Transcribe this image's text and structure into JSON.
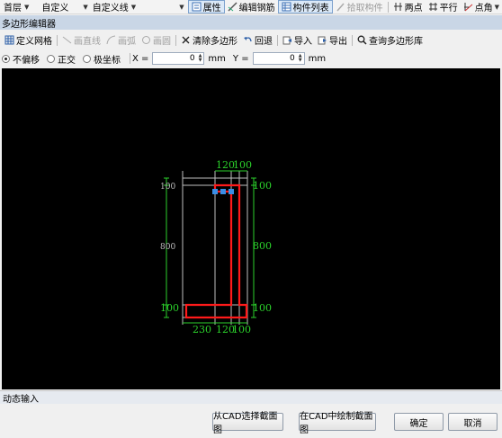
{
  "top_toolbar": {
    "floor": "首层",
    "custom": "自定义",
    "custom_line": "自定义线",
    "blank_dd": "",
    "attributes": "属性",
    "edit_rebar": "编辑钢筋",
    "component_list": "构件列表",
    "pick_component": "拾取构件",
    "two_points": "两点",
    "parallel": "平行",
    "point_angle": "点角"
  },
  "dialog": {
    "title": "多边形编辑器"
  },
  "edit_toolbar": {
    "define_grid": "定义网格",
    "draw_line": "画直线",
    "draw_arc": "画弧",
    "draw_circle": "画圆",
    "clear_polygon": "清除多边形",
    "undo": "回退",
    "import": "导入",
    "export": "导出",
    "query_library": "查询多边形库"
  },
  "options": {
    "no_offset": "不偏移",
    "orthogonal": "正交",
    "polar": "极坐标",
    "x_label": "X =",
    "x_value": "0",
    "x_unit": "mm",
    "y_label": "Y =",
    "y_value": "0",
    "y_unit": "mm",
    "selected": "不偏移"
  },
  "drawing": {
    "dims": {
      "top_a": "120",
      "top_b": "100",
      "left_top": "100",
      "left_mid": "800",
      "left_bot": "100",
      "right_top": "100",
      "right_mid": "800",
      "right_bot": "100",
      "bottom_a": "230",
      "bottom_b": "120",
      "bottom_c": "100"
    },
    "colors": {
      "canvas": "#000000",
      "shape": "#ff1a1a",
      "dim": "#2bd12b",
      "grid": "#bfbfbf",
      "handle": "#3a8ee6"
    }
  },
  "dynamic_input": "动态输入",
  "buttons": {
    "select_from_cad": "从CAD选择截面图",
    "draw_in_cad": "在CAD中绘制截面图",
    "ok": "确定",
    "cancel": "取消"
  }
}
